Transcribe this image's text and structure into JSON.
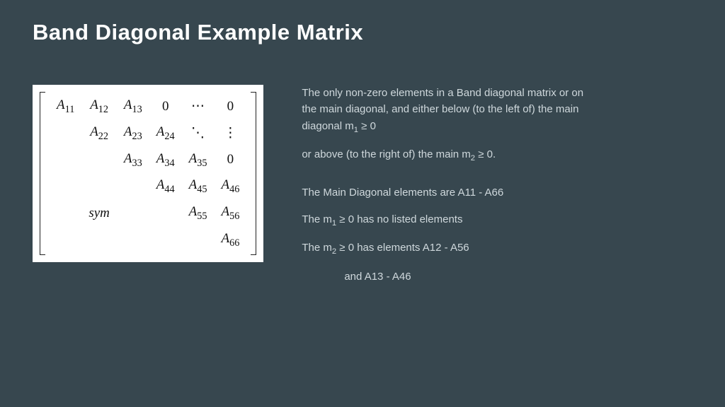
{
  "title": "Band Diagonal Example Matrix",
  "matrix": {
    "rows": [
      [
        "A|11",
        "A|12",
        "A|13",
        "0",
        "⋯",
        "0"
      ],
      [
        "",
        "A|22",
        "A|23",
        "A|24",
        "⋱",
        "⋮"
      ],
      [
        "",
        "",
        "A|33",
        "A|34",
        "A|35",
        "0"
      ],
      [
        "",
        "",
        "",
        "A|44",
        "A|45",
        "A|46"
      ],
      [
        "",
        "sym",
        "",
        "",
        "A|55",
        "A|56"
      ],
      [
        "",
        "",
        "",
        "",
        "",
        "A|66"
      ]
    ]
  },
  "desc": {
    "p1a": "The only non-zero elements in a Band diagonal matrix or on the main diagonal, and either below (to the left of) the main diagonal m",
    "p1b": "  ≥  0",
    "p2a": "or above (to the right of) the main m",
    "p2b": " ≥  0.",
    "p3": "The Main Diagonal elements are A11 - A66",
    "p4a": "The  m",
    "p4b": "  ≥  0 has no listed elements",
    "p5a": "The m",
    "p5b": " ≥  0  has elements  A12 - A56",
    "p6": "and A13 - A46",
    "sub1": "1",
    "sub2": "2"
  }
}
